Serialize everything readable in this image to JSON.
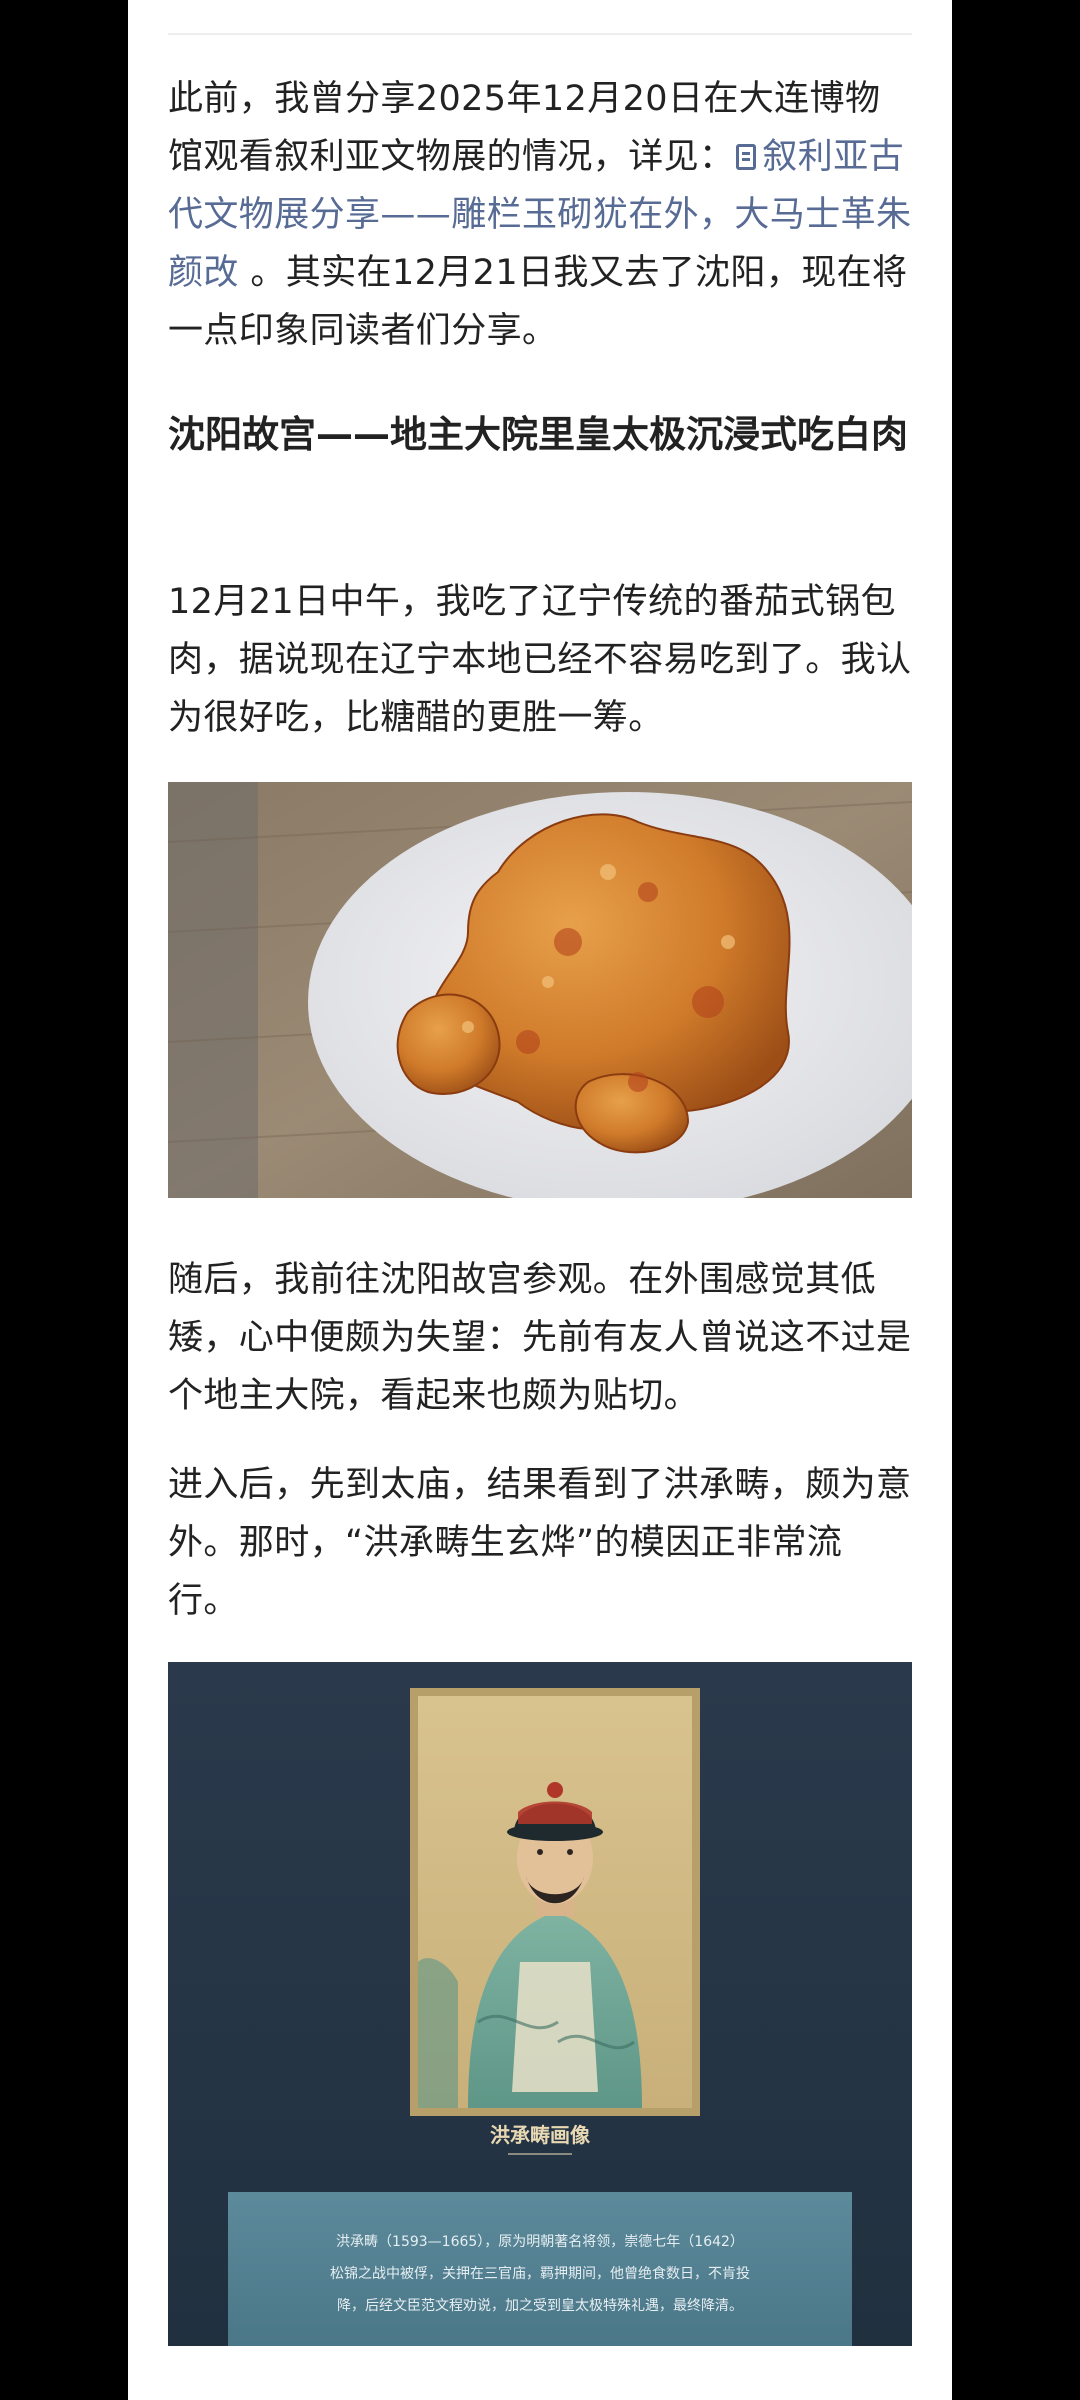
{
  "article": {
    "para1": {
      "before": "此前，我曾分享2025年12月20日在大连博物馆观看叙利亚文物展的情况，详见：",
      "link": "叙利亚古代文物展分享——雕栏玉砌犹在外，大马士革朱颜改",
      "after": "。其实在12月21日我又去了沈阳，现在将一点印象同读者们分享。"
    },
    "heading1": "沈阳故宫——地主大院里皇太极沉浸式吃白肉",
    "para2": "12月21日中午，我吃了辽宁传统的番茄式锅包肉，据说现在辽宁本地已经不容易吃到了。我认为很好吃，比糖醋的更胜一筹。",
    "para3": "随后，我前往沈阳故宫参观。在外围感觉其低矮，心中便颇为失望：先前有友人曾说这不过是个地主大院，看起来也颇为贴切。",
    "para4": "进入后，先到太庙，结果看到了洪承畴，颇为意外。那时，“洪承畴生玄烨”的模因正非常流行。",
    "photo2": {
      "caption_title": "洪承畴画像",
      "caption_lines": [
        "洪承畴（1593—1665），原为明朝著名将领，崇德七年（1642）",
        "松锦之战中被俘，关押在三官庙，羁押期间，他曾绝食数日，不肯投",
        "降，后经文臣范文程劝说，加之受到皇太极特殊礼遇，最终降清。"
      ]
    }
  },
  "colors": {
    "text": "#222222",
    "link": "#576b95",
    "background": "#ffffff",
    "side_bars": "#000000"
  },
  "icons": [
    "document-icon"
  ]
}
